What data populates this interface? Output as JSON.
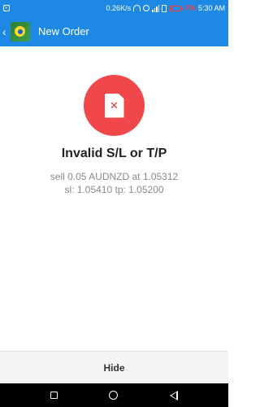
{
  "status_bar": {
    "network_speed": "0.26K/s",
    "battery_percent": "7%",
    "time": "5:30 AM",
    "icons": [
      "notification-icon",
      "headphone-icon",
      "alarm-icon",
      "signal-icon",
      "sim-icon",
      "battery-icon"
    ]
  },
  "app_bar": {
    "title": "New Order",
    "back_icon": "back-arrow-icon",
    "app_icon": "metatrader-app-icon"
  },
  "result": {
    "icon": "document-error-icon",
    "icon_mark": "✕",
    "title": "Invalid S/L or T/P",
    "detail_line1": "sell 0.05 AUDNZD at 1.05312",
    "detail_line2": "sl: 1.05410 tp: 1.05200"
  },
  "actions": {
    "hide_label": "Hide"
  },
  "colors": {
    "accent": "#1e88e5",
    "error": "#f0474b",
    "battery_low": "#ff3b30"
  }
}
